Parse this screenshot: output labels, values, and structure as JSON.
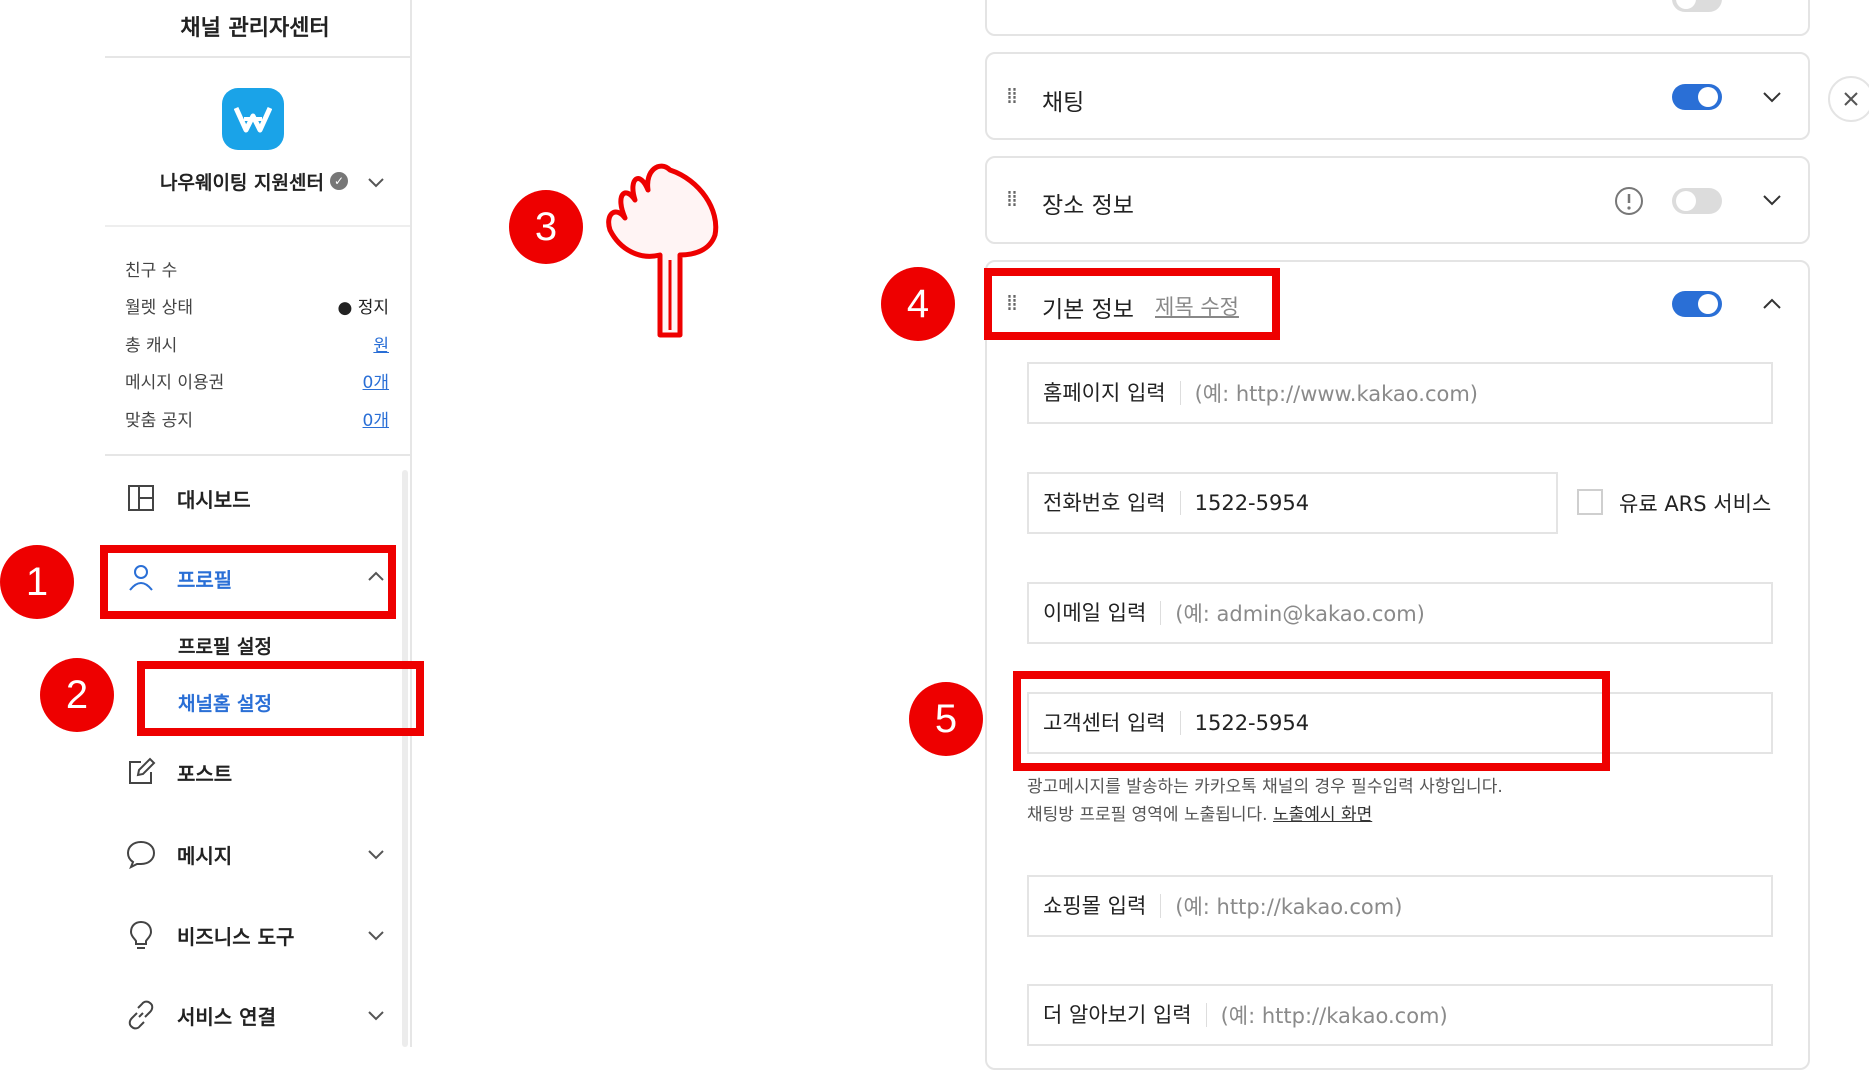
{
  "sidebar": {
    "app_title": "채널 관리자센터",
    "channel_name": "나우웨이팅 지원센터",
    "stats": [
      {
        "label": "친구 수",
        "value": ""
      },
      {
        "label": "월렛 상태",
        "value": "● 정지"
      },
      {
        "label": "총 캐시",
        "value": "원"
      },
      {
        "label": "메시지 이용권",
        "value": "0개"
      },
      {
        "label": "맞춤 공지",
        "value": "0개"
      }
    ],
    "nav": {
      "dashboard": "대시보드",
      "profile": "프로필",
      "profile_settings": "프로필 설정",
      "channel_home_settings": "채널홈 설정",
      "post": "포스트",
      "message": "메시지",
      "business_tools": "비즈니스 도구",
      "service_link": "서비스 연결"
    }
  },
  "annotations": [
    "1",
    "2",
    "3",
    "4",
    "5"
  ],
  "main": {
    "cards": {
      "chatting": "채팅",
      "place_info": "장소 정보",
      "basic_info": "기본 정보",
      "edit_title": "제목 수정"
    },
    "fields": {
      "homepage": {
        "label": "홈페이지 입력",
        "placeholder": "(예: http://www.kakao.com)"
      },
      "phone": {
        "label": "전화번호 입력",
        "value": "1522-5954"
      },
      "paid_ars": "유료 ARS 서비스",
      "email": {
        "label": "이메일 입력",
        "placeholder": "(예: admin@kakao.com)"
      },
      "cs_center": {
        "label": "고객센터 입력",
        "value": "1522-5954"
      },
      "cs_help_line1": "광고메시지를 발송하는 카카오톡 채널의 경우 필수입력 사항입니다.",
      "cs_help_line2": "채팅방 프로필 영역에 노출됩니다.",
      "cs_help_link": "노출예시 화면",
      "shopping": {
        "label": "쇼핑몰 입력",
        "placeholder": "(예: http://kakao.com)"
      },
      "more": {
        "label": "더 알아보기 입력",
        "placeholder": "(예: http://kakao.com)"
      }
    },
    "toggles": {
      "chatting": true,
      "place_info": false,
      "basic_info": true
    },
    "colors": {
      "accent": "#2a6fd6",
      "annotation": "#ee0000",
      "logo": "#1aa3e8"
    }
  }
}
